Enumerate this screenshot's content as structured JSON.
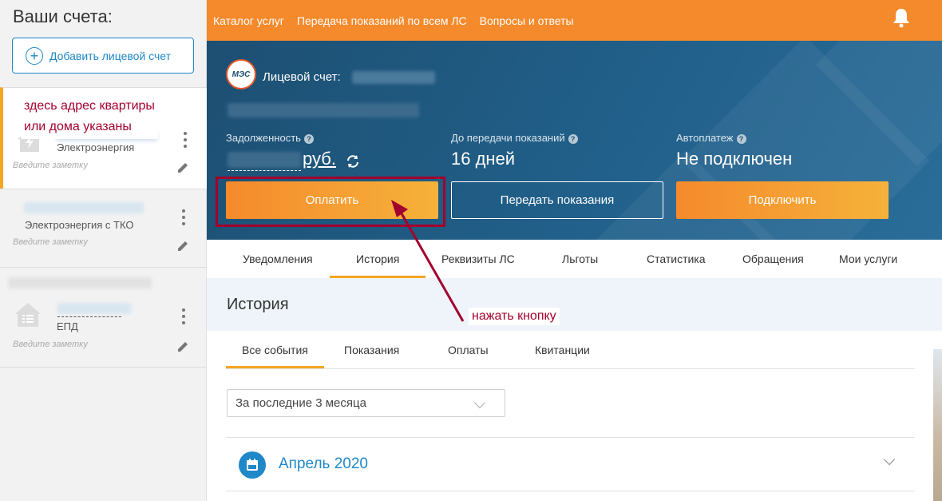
{
  "sidebar": {
    "title": "Ваши счета:",
    "add_button": "Добавить лицевой счет",
    "accounts": [
      {
        "type": "Электроэнергия",
        "note_placeholder": "Введите заметку"
      },
      {
        "type": "Электроэнергия с ТКО",
        "note_placeholder": "Введите заметку"
      },
      {
        "type": "ЕПД",
        "note_placeholder": "Введите заметку"
      }
    ],
    "callout": "здесь адрес квартиры\nили дома указаны"
  },
  "topnav": {
    "links": [
      "Каталог услуг",
      "Передача показаний по всем ЛС",
      "Вопросы и ответы"
    ]
  },
  "hero": {
    "logo": "МЭС",
    "account_label": "Лицевой счет:",
    "debt_label": "Задолженность",
    "debt_unit": "руб.",
    "days_label": "До передачи показаний",
    "days_value": "16 дней",
    "autopay_label": "Автоплатеж",
    "autopay_value": "Не подключен",
    "pay_button": "Оплатить",
    "submit_button": "Передать показания",
    "connect_button": "Подключить",
    "q_mark": "?"
  },
  "tabs": [
    "Уведомления",
    "История",
    "Реквизиты ЛС",
    "Льготы",
    "Статистика",
    "Обращения",
    "Мои услуги"
  ],
  "history": {
    "title": "История",
    "annotation": "нажать кнопку",
    "sub_tabs": [
      "Все события",
      "Показания",
      "Оплаты",
      "Квитанции"
    ],
    "period_select": "За последние 3 месяца",
    "month": "Апрель 2020"
  },
  "colors": {
    "accent": "#f58a2c",
    "brand_blue": "#1e88c8",
    "hero_bg": "#1d4f72",
    "annotation": "#a3002e"
  }
}
